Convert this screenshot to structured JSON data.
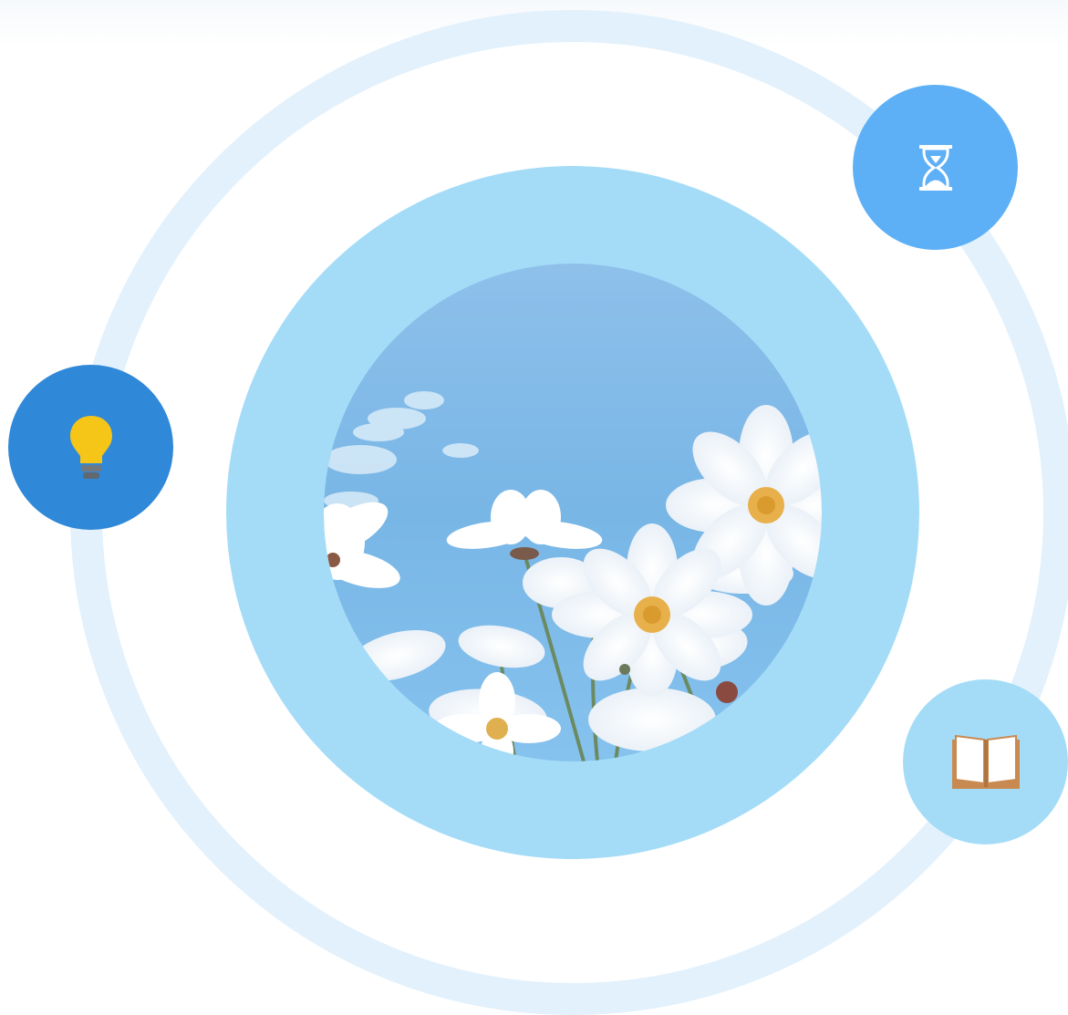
{
  "scene": {
    "photo": {
      "subject": "white-cosmos-flowers-against-blue-sky"
    },
    "icons": [
      {
        "name": "lightbulb-icon",
        "bubble_color": "#3088d8",
        "glyph_color": "#f5c518"
      },
      {
        "name": "hourglass-icon",
        "bubble_color": "#5eb0f6",
        "glyph_color": "#ffffff"
      },
      {
        "name": "book-icon",
        "bubble_color": "#a4dcf8",
        "glyph_color": "#c88a50"
      }
    ],
    "colors": {
      "orbit": "#e2f1fc",
      "outer_disc": "#a4dcf8",
      "sky": "#7ab8e6"
    }
  }
}
